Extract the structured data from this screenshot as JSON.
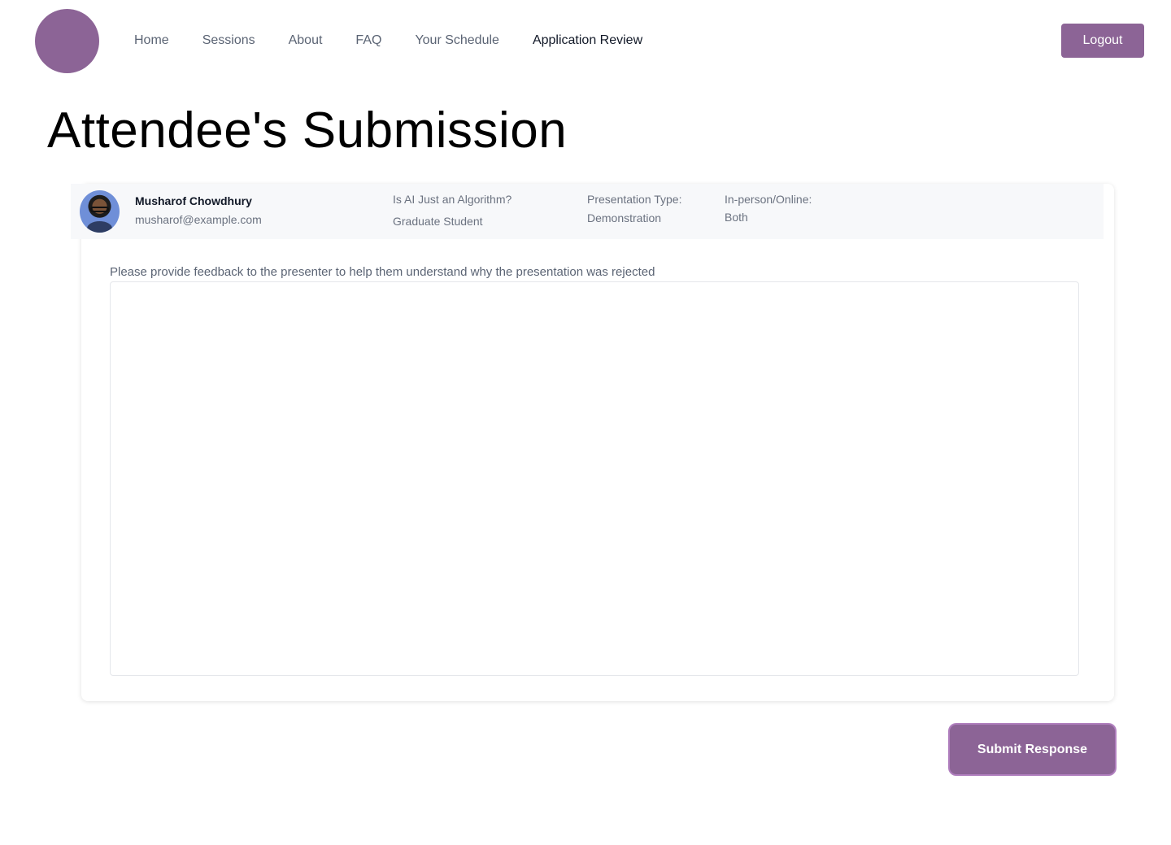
{
  "header": {
    "nav": [
      "Home",
      "Sessions",
      "About",
      "FAQ",
      "Your Schedule",
      "Application Review"
    ],
    "active_nav": "Application Review",
    "logout_label": "Logout",
    "brand_color": "#8c6496"
  },
  "page": {
    "title": "Attendee's Submission"
  },
  "submission": {
    "name": "Musharof Chowdhury",
    "email": "musharof@example.com",
    "topic": "Is AI Just an Algorithm?",
    "role": "Graduate Student",
    "presentation_type_label": "Presentation Type:",
    "presentation_type": "Demonstration",
    "mode_label": "In-person/Online:",
    "mode": "Both"
  },
  "feedback": {
    "label": "Please provide feedback to the presenter to help them understand why the presentation was rejected",
    "value": ""
  },
  "actions": {
    "submit_label": "Submit Response"
  }
}
